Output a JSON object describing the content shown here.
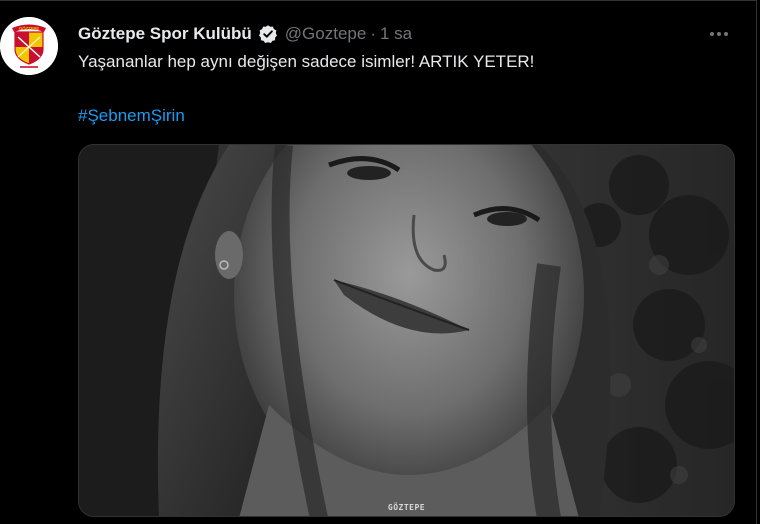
{
  "tweet": {
    "display_name": "Göztepe Spor Kulübü",
    "handle": "@Goztepe",
    "separator": "·",
    "time": "1 sa",
    "text": "Yaşananlar hep aynı değişen sadece isimler! ARTIK YETER!",
    "hashtag": "#ŞebnemŞirin",
    "avatar_logo_text": "GÖZTEPE",
    "media_watermark": "GÖZTEPE"
  },
  "icons": {
    "verified": "verified-badge-icon",
    "more": "more-horizontal-icon"
  },
  "colors": {
    "background": "#000000",
    "primary_text": "#e7e9ea",
    "secondary_text": "#71767b",
    "link": "#1d9bf0",
    "border": "#2f3336",
    "logo_red": "#c8102e",
    "logo_yellow": "#f2c500"
  }
}
